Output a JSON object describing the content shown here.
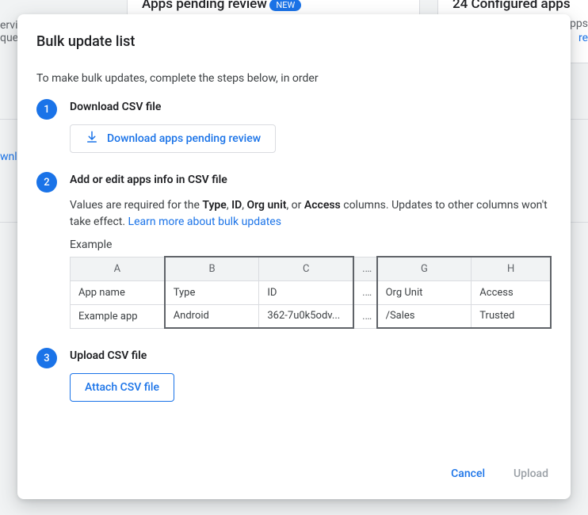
{
  "background": {
    "card1_title": "Apps pending review",
    "card1_badge": "NEW",
    "card2_title": "24 Configured apps",
    "right_frag1": "apps",
    "right_frag2": "re",
    "left_frag1": "ervic",
    "left_frag2": "que",
    "left_link": "wnl"
  },
  "modal": {
    "title": "Bulk update list",
    "subtitle": "To make bulk updates, complete the steps below, in order",
    "steps": {
      "s1": {
        "num": "1",
        "title": "Download CSV file",
        "button": "Download apps pending review"
      },
      "s2": {
        "num": "2",
        "title": "Add or edit apps info in CSV file",
        "desc_pre": "Values are required for the ",
        "req_type": "Type",
        "req_id": "ID",
        "req_org": "Org unit",
        "req_access": "Access",
        "desc_mid1": ", ",
        "desc_mid2": ", ",
        "desc_mid3": ", or ",
        "desc_post": " columns. Updates to other columns won't take effect. ",
        "learn_more": "Learn more about bulk updates",
        "example_label": "Example",
        "table": {
          "cols": [
            "A",
            "B",
            "C",
            "...",
            "G",
            "H"
          ],
          "headers": [
            "App name",
            "Type",
            "ID",
            "...",
            "Org Unit",
            "Access"
          ],
          "row": [
            "Example app",
            "Android",
            "362-7u0k5odv...",
            "...",
            "/Sales",
            "Trusted"
          ]
        }
      },
      "s3": {
        "num": "3",
        "title": "Upload CSV file",
        "button": "Attach CSV file"
      }
    },
    "actions": {
      "cancel": "Cancel",
      "upload": "Upload"
    }
  }
}
